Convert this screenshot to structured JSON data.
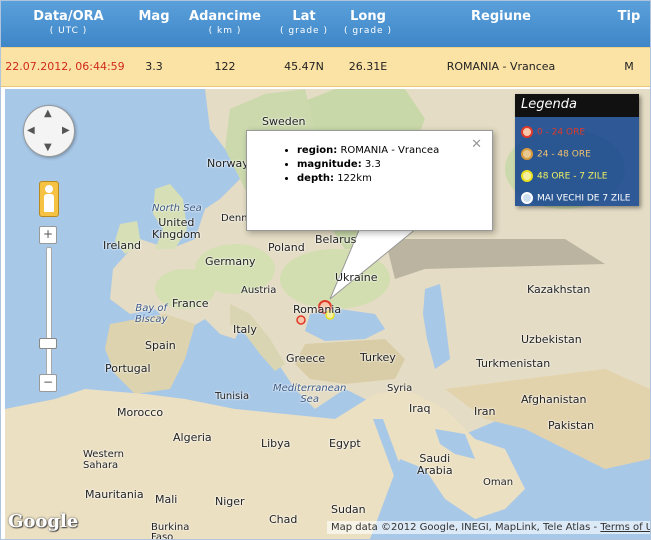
{
  "table": {
    "headers": [
      {
        "label": "Data/ORA",
        "sub": "( UTC )"
      },
      {
        "label": "Mag",
        "sub": ""
      },
      {
        "label": "Adancime",
        "sub": "( km )"
      },
      {
        "label": "Lat",
        "sub": "( grade )"
      },
      {
        "label": "Long",
        "sub": "( grade )"
      },
      {
        "label": "Regiune",
        "sub": ""
      },
      {
        "label": "Tip",
        "sub": ""
      }
    ],
    "row": {
      "date": "22.07.2012, 06:44:59",
      "mag": "3.3",
      "depth": "122",
      "lat": "45.47N",
      "long": "26.31E",
      "region": "ROMANIA - Vrancea",
      "type": "M"
    }
  },
  "map": {
    "labels": {
      "sweden": "Sweden",
      "norway": "Norway",
      "north_sea": "North Sea",
      "denmark": "Denma",
      "united_kingdom": "United\nKingdom",
      "ireland": "Ireland",
      "poland": "Poland",
      "belarus": "Belarus",
      "germany": "Germany",
      "ukraine": "Ukraine",
      "austria": "Austria",
      "france": "France",
      "bay_of_biscay": "Bay of\nBiscay",
      "romania": "Romania",
      "italy": "Italy",
      "kazakhstan": "Kazakhstan",
      "uzbekistan": "Uzbekistan",
      "spain": "Spain",
      "greece": "Greece",
      "turkey": "Turkey",
      "turkmenistan": "Turkmenistan",
      "portugal": "Portugal",
      "mediterranean_sea": "Mediterranean\nSea",
      "syria": "Syria",
      "iraq": "Iraq",
      "iran": "Iran",
      "afghanistan": "Afghanistan",
      "morocco": "Morocco",
      "tunisia": "Tunisia",
      "algeria": "Algeria",
      "libya": "Libya",
      "egypt": "Egypt",
      "pakistan": "Pakistan",
      "western_sahara": "Western\nSahara",
      "saudi_arabia": "Saudi\nArabia",
      "mauritania": "Mauritania",
      "mali": "Mali",
      "niger": "Niger",
      "oman": "Oman",
      "chad": "Chad",
      "sudan": "Sudan",
      "burkina_faso": "Burkina\nFaso"
    },
    "legend": {
      "title": "Legenda",
      "items": [
        {
          "label": "0 - 24 ORE",
          "color": "#e03a2a"
        },
        {
          "label": "24 - 48 ORE",
          "color": "#d89a3a"
        },
        {
          "label": "48 ORE - 7 ZILE",
          "color": "#e8e020"
        },
        {
          "label": "MAI VECHI DE 7 ZILE",
          "color": "#ffffff"
        }
      ]
    },
    "info_window": {
      "region_key": "region:",
      "region_val": "ROMANIA - Vrancea",
      "magnitude_key": "magnitude:",
      "magnitude_val": "3.3",
      "depth_key": "depth:",
      "depth_val": "122km"
    },
    "footer": {
      "attribution": "Map data ©2012 Google, INEGI, MapLink, Tele Atlas -",
      "terms": "Terms of Use"
    },
    "logo": "Google"
  }
}
